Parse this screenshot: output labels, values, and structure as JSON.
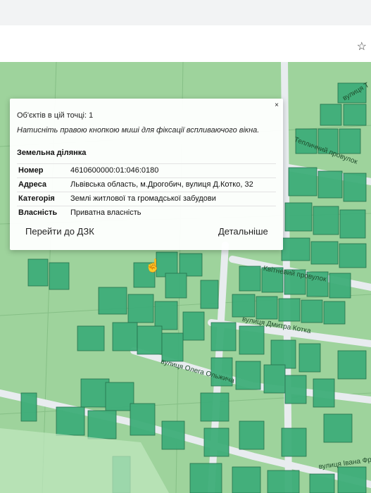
{
  "browser": {
    "star_icon": "star-icon"
  },
  "popup": {
    "close_label": "×",
    "objects_count": "Об'єктів в цій точці: 1",
    "hint": "Натисніть правою кнопкою миші для фіксації вспливаючого вікна.",
    "section_title": "Земельна ділянка",
    "rows": [
      {
        "key": "Номер",
        "value": "4610600000:01:046:0180"
      },
      {
        "key": "Адреса",
        "value": "Львівська область, м.Дрогобич, вулиця Д.Котко, 32"
      },
      {
        "key": "Категорія",
        "value": "Землі житлової та громадської забудови"
      },
      {
        "key": "Власність",
        "value": "Приватна власність"
      }
    ],
    "go_button": "Перейти до ДЗК",
    "details_button": "Детальніше"
  },
  "map": {
    "street_labels": [
      "вулиця Т",
      "Тепличний провулок",
      "Квітневий провулок",
      "вулиця Дмитра Котка",
      "вулиця Олега Ольжича",
      "вулиця Івана Фр"
    ],
    "colors": {
      "base": "#9ed39c",
      "parcel": "#3fae7a",
      "parcel_dark": "#2f8f63",
      "road": "#e8ecef",
      "edge": "#1f6b47"
    }
  }
}
